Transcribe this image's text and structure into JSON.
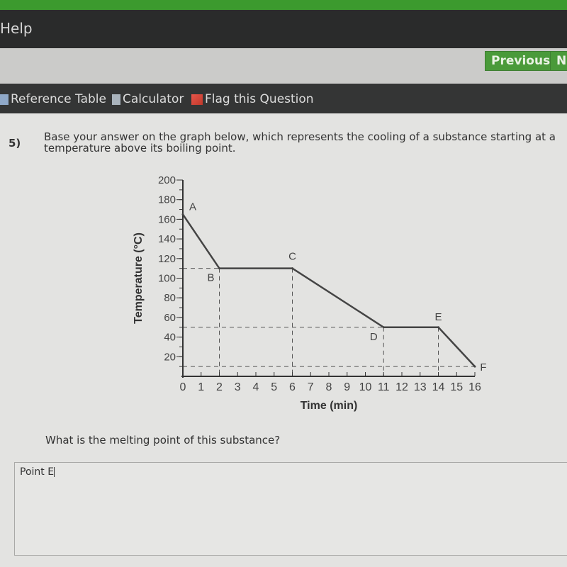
{
  "header": {
    "help_label": "Help",
    "previous_label": "Previous",
    "next_label": "Next",
    "accent_color": "#4a9a3a"
  },
  "toolbar": {
    "items": [
      {
        "icon": "table-icon",
        "label": "Reference Table"
      },
      {
        "icon": "calculator-icon",
        "label": "Calculator"
      },
      {
        "icon": "flag-icon",
        "label": "Flag this Question"
      }
    ]
  },
  "question": {
    "number": "5)",
    "text": "Base your answer on the graph below, which represents the cooling of a substance starting at a temperature above its boiling point.",
    "prompt": "What is the melting point of this substance?",
    "answer_value": "Point E"
  },
  "chart_data": {
    "type": "line",
    "title": "",
    "xlabel": "Time (min)",
    "ylabel": "Temperature (°C)",
    "xlim": [
      0,
      16
    ],
    "ylim": [
      0,
      200
    ],
    "xticks": [
      0,
      1,
      2,
      3,
      4,
      5,
      6,
      7,
      8,
      9,
      10,
      11,
      12,
      13,
      14,
      15,
      16
    ],
    "yticks": [
      20,
      40,
      60,
      80,
      100,
      120,
      140,
      160,
      180,
      200
    ],
    "points": [
      {
        "label": "A",
        "x": 0,
        "y": 165
      },
      {
        "label": "B",
        "x": 2,
        "y": 110
      },
      {
        "label": "C",
        "x": 6,
        "y": 110
      },
      {
        "label": "D",
        "x": 11,
        "y": 50
      },
      {
        "label": "E",
        "x": 14,
        "y": 50
      },
      {
        "label": "F",
        "x": 16,
        "y": 10
      }
    ],
    "reference_lines": {
      "horizontal": [
        110,
        50,
        10
      ],
      "vertical": [
        2,
        6,
        11,
        14
      ]
    }
  }
}
